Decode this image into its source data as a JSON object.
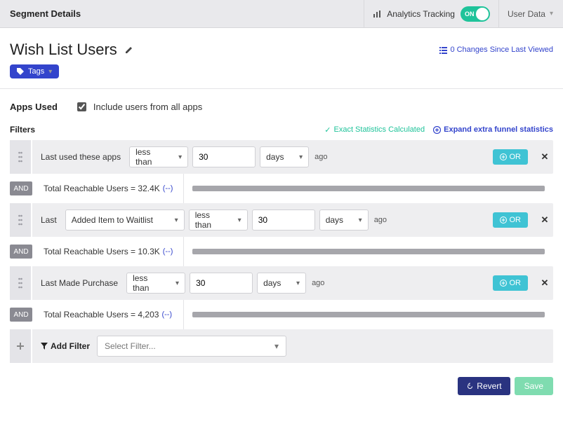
{
  "topbar": {
    "title": "Segment Details",
    "analytics_label": "Analytics Tracking",
    "toggle_state": "ON",
    "user_menu": "User Data"
  },
  "page": {
    "title": "Wish List Users",
    "changes_text": "0 Changes Since Last Viewed",
    "tags_btn": "Tags"
  },
  "apps": {
    "section_label": "Apps Used",
    "include_label": "Include users from all apps"
  },
  "filters_head": {
    "label": "Filters",
    "status": "Exact Statistics Calculated",
    "expand": "Expand extra funnel statistics"
  },
  "filters": [
    {
      "label": "Last used these apps",
      "event_select": null,
      "op": "less than",
      "value": "30",
      "unit": "days",
      "ago": "ago",
      "or": "OR",
      "and_badge": "AND",
      "result_prefix": "Total Reachable Users = ",
      "result_value": "32.4K",
      "result_link": "(--)",
      "bar_pct": 100
    },
    {
      "label": "Last",
      "event_select": "Added Item to Waitlist",
      "op": "less than",
      "value": "30",
      "unit": "days",
      "ago": "ago",
      "or": "OR",
      "and_badge": "AND",
      "result_prefix": "Total Reachable Users = ",
      "result_value": "10.3K",
      "result_link": "(--)",
      "bar_pct": 100
    },
    {
      "label": "Last Made Purchase",
      "event_select": null,
      "op": "less than",
      "value": "30",
      "unit": "days",
      "ago": "ago",
      "or": "OR",
      "and_badge": "AND",
      "result_prefix": "Total Reachable Users = ",
      "result_value": "4,203",
      "result_link": "(--)",
      "bar_pct": 100
    }
  ],
  "add_filter": {
    "label": "Add Filter",
    "placeholder": "Select Filter..."
  },
  "footer": {
    "revert": "Revert",
    "save": "Save"
  }
}
